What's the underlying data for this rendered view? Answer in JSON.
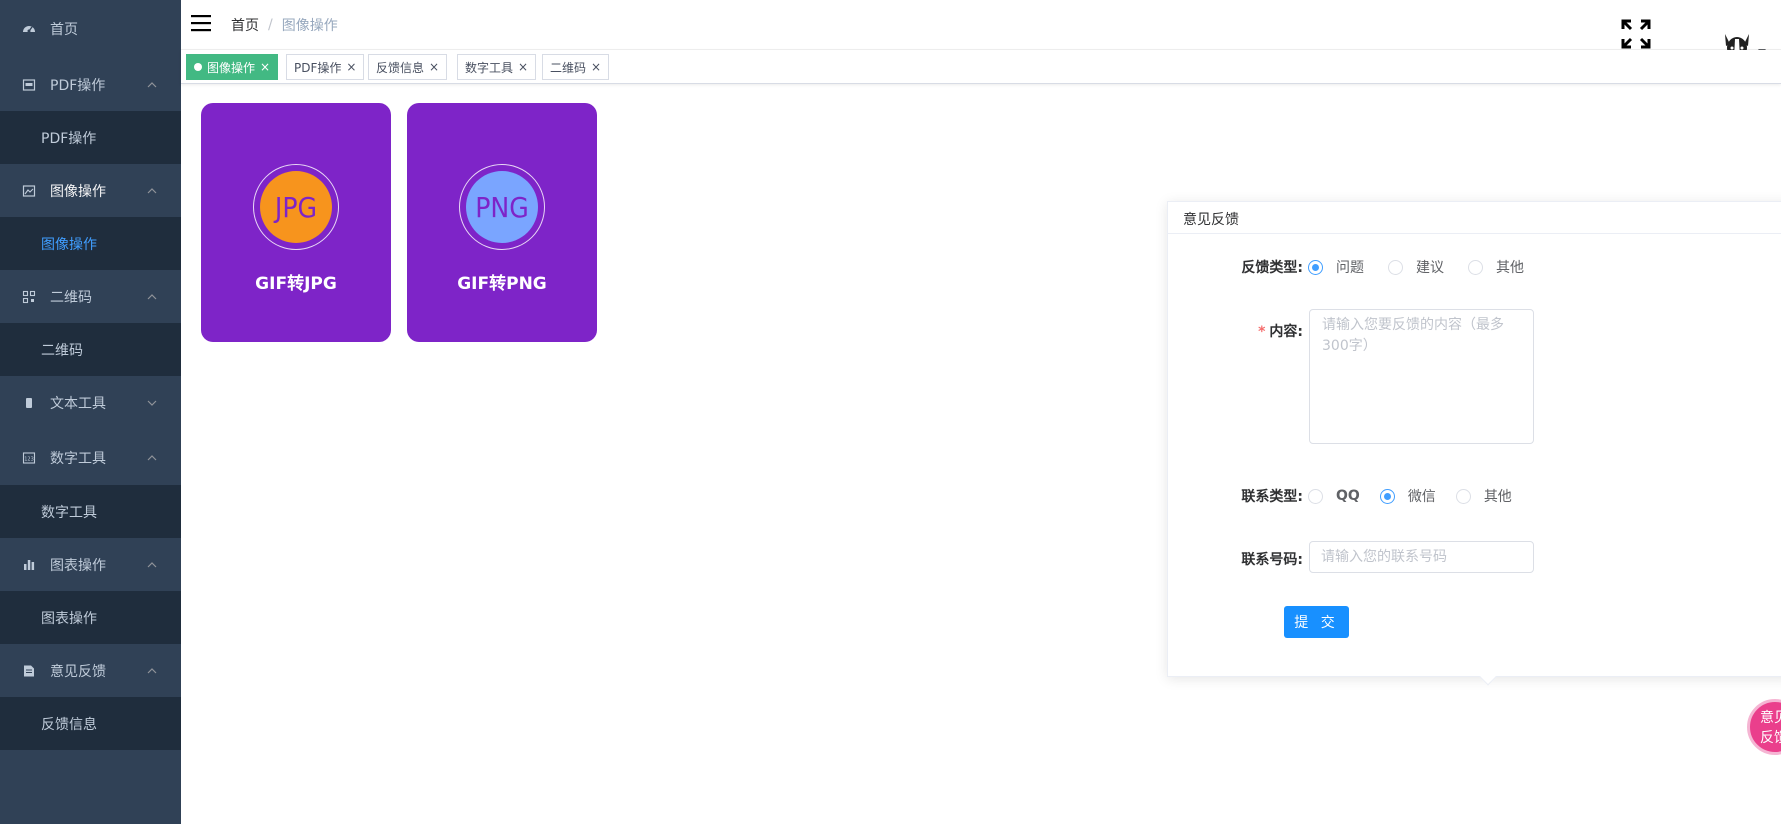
{
  "sidebar": {
    "items": [
      {
        "label": "首页",
        "icon": "dashboard-icon"
      },
      {
        "label": "PDF操作",
        "icon": "pdf-icon",
        "sub": "PDF操作"
      },
      {
        "label": "图像操作",
        "icon": "image-icon",
        "sub": "图像操作"
      },
      {
        "label": "二维码",
        "icon": "qrcode-icon",
        "sub": "二维码"
      },
      {
        "label": "文本工具",
        "icon": "text-icon"
      },
      {
        "label": "数字工具",
        "icon": "number-icon",
        "sub": "数字工具"
      },
      {
        "label": "图表操作",
        "icon": "chart-icon",
        "sub": "图表操作"
      },
      {
        "label": "意见反馈",
        "icon": "feedback-icon",
        "sub": "反馈信息"
      }
    ]
  },
  "breadcrumb": {
    "home": "首页",
    "separator": "/",
    "current": "图像操作"
  },
  "tags": [
    {
      "label": "图像操作",
      "active": true
    },
    {
      "label": "PDF操作"
    },
    {
      "label": "反馈信息"
    },
    {
      "label": "数字工具"
    },
    {
      "label": "二维码"
    }
  ],
  "tag_close": "×",
  "cards": [
    {
      "badge": "JPG",
      "title": "GIF转JPG"
    },
    {
      "badge": "PNG",
      "title": "GIF转PNG"
    }
  ],
  "feedback": {
    "title": "意见反馈",
    "type_label": "反馈类型:",
    "type_options": [
      "问题",
      "建议",
      "其他"
    ],
    "content_required": "*",
    "content_label": "内容:",
    "content_placeholder": "请输入您要反馈的内容（最多300字）",
    "contact_type_label": "联系类型:",
    "contact_options": [
      "QQ",
      "微信",
      "其他"
    ],
    "contact_number_label": "联系号码:",
    "contact_number_placeholder": "请输入您的联系号码",
    "submit": "提 交"
  },
  "bubble": {
    "line1": "意见",
    "line2": "反馈"
  },
  "colors": {
    "sidebar_bg": "#304156",
    "submenu_bg": "#1f2d3d",
    "active_link": "#409eff",
    "tag_active": "#42b983",
    "card_bg": "#7e24c8",
    "primary_button": "#1890ff"
  }
}
